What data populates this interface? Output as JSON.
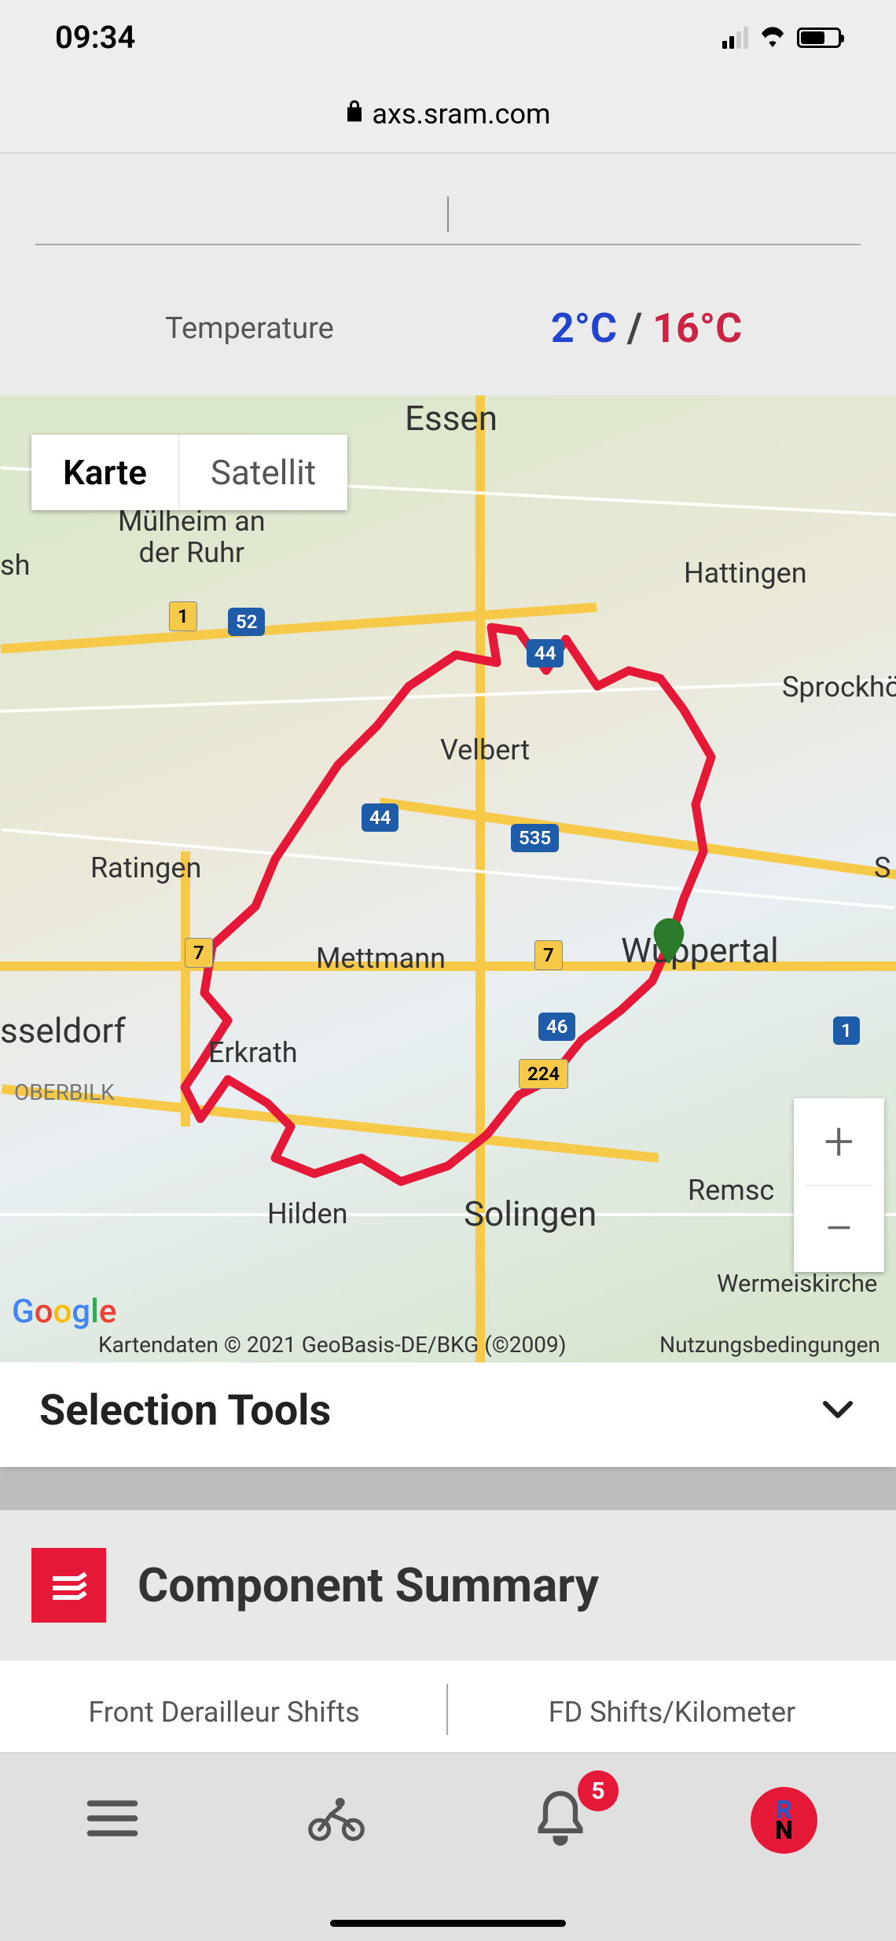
{
  "status": {
    "time": "09:34"
  },
  "browser": {
    "url": "axs.sram.com"
  },
  "temperature": {
    "label": "Temperature",
    "min": "2°C",
    "separator": " / ",
    "max": "16°C"
  },
  "map": {
    "type_controls": {
      "map": "Karte",
      "satellite": "Satellit"
    },
    "cities": {
      "essen": "Essen",
      "muelheim": "Mülheim an der Ruhr",
      "hattingen": "Hattingen",
      "velbert": "Velbert",
      "sprockhoe": "Sprockhö",
      "ratingen": "Ratingen",
      "mettmann": "Mettmann",
      "wuppertal": "Wuppertal",
      "dusseldorf": "sseldorf",
      "erkrath": "Erkrath",
      "oberbilk": "OBERBILK",
      "hilden": "Hilden",
      "solingen": "Solingen",
      "remsc": "Remsc",
      "wermelskirche": "Wermeiskirche",
      "s": "S",
      "sh": "sh"
    },
    "shields": {
      "s1a": "1",
      "s52": "52",
      "s44a": "44",
      "s44b": "44",
      "s535": "535",
      "s7a": "7",
      "s7b": "7",
      "s46": "46",
      "s224": "224",
      "s1b": "1"
    },
    "zoom": {
      "in": "+",
      "out": "−"
    },
    "logo": "Google",
    "attribution": "Kartendaten © 2021 GeoBasis-DE/BKG (©2009)",
    "terms": "Nutzungsbedingungen"
  },
  "selection_tools": {
    "label": "Selection Tools"
  },
  "component_summary": {
    "title": "Component Summary",
    "stats": {
      "front_derailleur": "Front Derailleur Shifts",
      "fd_per_km": "FD Shifts/Kilometer"
    }
  },
  "bottom_nav": {
    "badge_count": "5",
    "avatar_letters": {
      "r": "R",
      "n": "N"
    }
  }
}
